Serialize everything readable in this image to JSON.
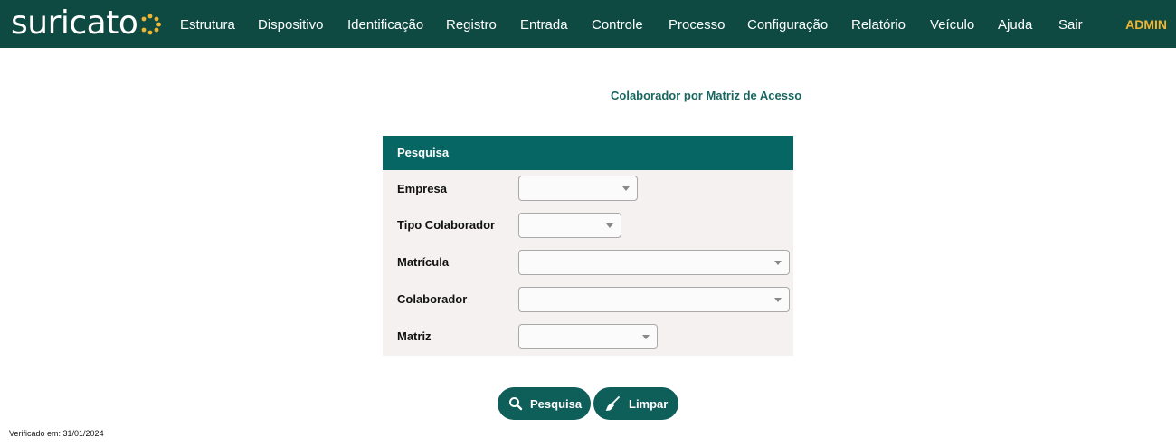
{
  "brand": {
    "logo_text": "suricato",
    "logo_accent": "#f2b531"
  },
  "nav": {
    "items": [
      {
        "label": "Estrutura"
      },
      {
        "label": "Dispositivo"
      },
      {
        "label": "Identificação"
      },
      {
        "label": "Registro"
      },
      {
        "label": "Entrada"
      },
      {
        "label": "Controle"
      },
      {
        "label": "Processo"
      },
      {
        "label": "Configuração"
      },
      {
        "label": "Relatório"
      },
      {
        "label": "Veículo"
      },
      {
        "label": "Ajuda"
      },
      {
        "label": "Sair"
      }
    ],
    "user": "ADMIN"
  },
  "page": {
    "title": "Colaborador por Matriz de Acesso"
  },
  "panel": {
    "header": "Pesquisa",
    "fields": [
      {
        "label": "Empresa",
        "value": ""
      },
      {
        "label": "Tipo Colaborador",
        "value": ""
      },
      {
        "label": "Matrícula",
        "value": ""
      },
      {
        "label": "Colaborador",
        "value": ""
      },
      {
        "label": "Matriz",
        "value": ""
      }
    ]
  },
  "actions": {
    "search_label": "Pesquisa",
    "clear_label": "Limpar"
  },
  "footer": {
    "verified": "Verificado em: 31/01/2024"
  },
  "colors": {
    "navbar": "#0e4a42",
    "panel_header": "#066663",
    "title": "#176660",
    "button": "#0e5f5a",
    "user": "#f2b531"
  }
}
